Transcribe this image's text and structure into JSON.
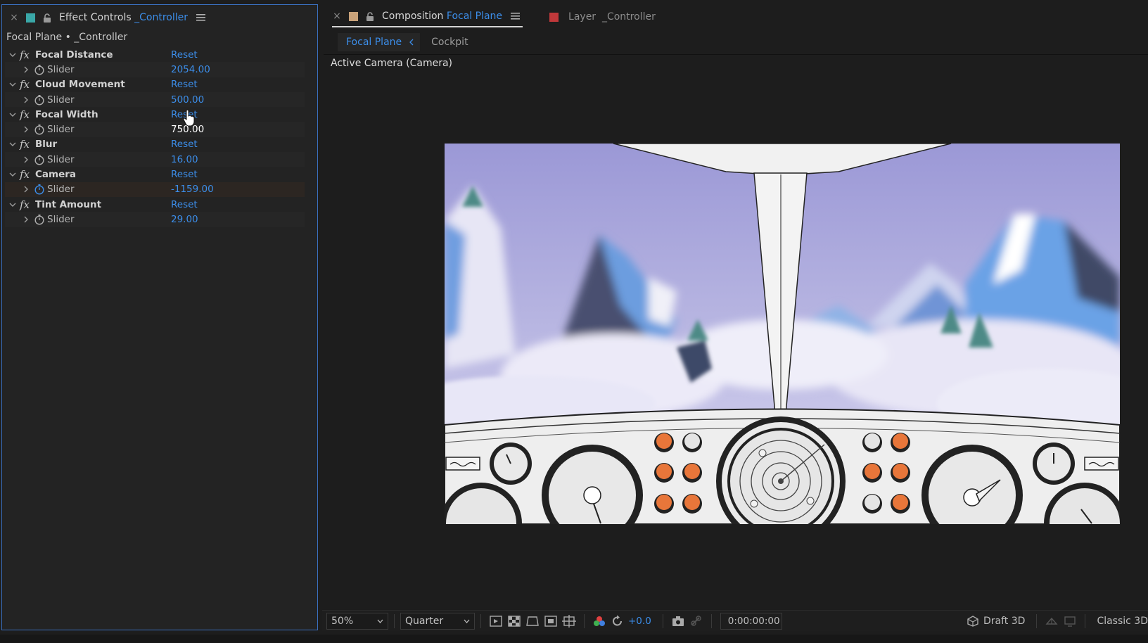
{
  "colors": {
    "accent": "#3c8eea",
    "effect_controls_swatch": "#3aa8a8",
    "composition_swatch": "#c9a27a",
    "layer_swatch": "#c0383a"
  },
  "effect_controls": {
    "tab_label": "Effect Controls",
    "tab_layer": "_Controller",
    "subheader": "Focal Plane • _Controller",
    "effects": [
      {
        "name": "Focal Distance",
        "reset": "Reset",
        "prop": "Slider",
        "value": "2054.00"
      },
      {
        "name": "Cloud Movement",
        "reset": "Reset",
        "prop": "Slider",
        "value": "500.00"
      },
      {
        "name": "Focal Width",
        "reset": "Reset",
        "prop": "Slider",
        "value": "750.00"
      },
      {
        "name": "Blur",
        "reset": "Reset",
        "prop": "Slider",
        "value": "16.00"
      },
      {
        "name": "Camera",
        "reset": "Reset",
        "prop": "Slider",
        "value": "-1159.00"
      },
      {
        "name": "Tint Amount",
        "reset": "Reset",
        "prop": "Slider",
        "value": "29.00"
      }
    ]
  },
  "composition": {
    "tab_prefix": "Composition",
    "tab_name": "Focal Plane",
    "layer_tab": "Layer  _Controller",
    "viewer_tabs": [
      "Focal Plane",
      "Cockpit"
    ],
    "camera_label": "Active Camera (Camera)"
  },
  "toolbar": {
    "zoom": "50%",
    "resolution": "Quarter",
    "exposure": "+0.0",
    "timecode": "0:00:00:00",
    "renderer": "Draft 3D",
    "renderer_mode": "Classic 3D"
  },
  "icons": {
    "close": "close-icon",
    "lock": "lock-icon",
    "menu": "hamburger-menu-icon",
    "stopwatch": "stopwatch-icon",
    "fx": "fx-badge-icon",
    "cursor": "hand-cursor-icon"
  }
}
